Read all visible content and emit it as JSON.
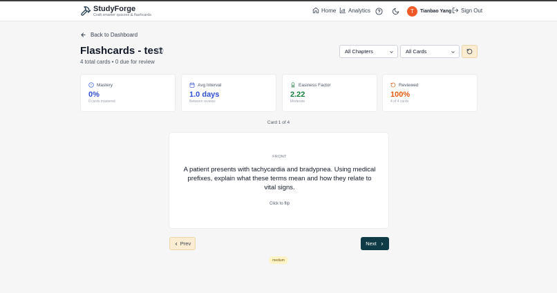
{
  "app": {
    "brand_name": "StudyForge",
    "brand_tagline": "Craft smarter quizzes & flashcards"
  },
  "nav": {
    "home": "Home",
    "analytics": "Analytics",
    "help_icon": "help-circle-icon",
    "theme_icon": "moon-icon",
    "user_initial": "T",
    "user_name": "Tianbao Yang",
    "sign_out": "Sign Out"
  },
  "page": {
    "back_label": "Back to Dashboard",
    "title": "Flashcards - test",
    "subtitle": "4 total cards • 0 due for review"
  },
  "filters": {
    "chapter_selected": "All Chapters",
    "cards_selected": "All Cards",
    "refresh_icon": "refresh-icon"
  },
  "stats": [
    {
      "label": "Mastery",
      "value": "0%",
      "desc": "0 cards mastered",
      "icon": "target-icon",
      "color": "#2f4fd8"
    },
    {
      "label": "Avg Interval",
      "value": "1.0 days",
      "desc": "Between reviews",
      "icon": "calendar-icon",
      "color": "#2f4fd8"
    },
    {
      "label": "Easiness Factor",
      "value": "2.22",
      "desc": "Moderate",
      "icon": "award-icon",
      "color": "#15803d"
    },
    {
      "label": "Reviewed",
      "value": "100%",
      "desc": "4 of 4 cards",
      "icon": "rotate-icon",
      "color": "#e8590c"
    }
  ],
  "study": {
    "counter": "Card 1 of 4",
    "side": "FRONT",
    "question": "A patient presents with tachycardia and bradypnea. Using medical prefixes, explain what these terms mean and how they relate to vital signs.",
    "hint": "Click to flip",
    "prev_label": "Prev",
    "next_label": "Next",
    "difficulty": "medium"
  }
}
